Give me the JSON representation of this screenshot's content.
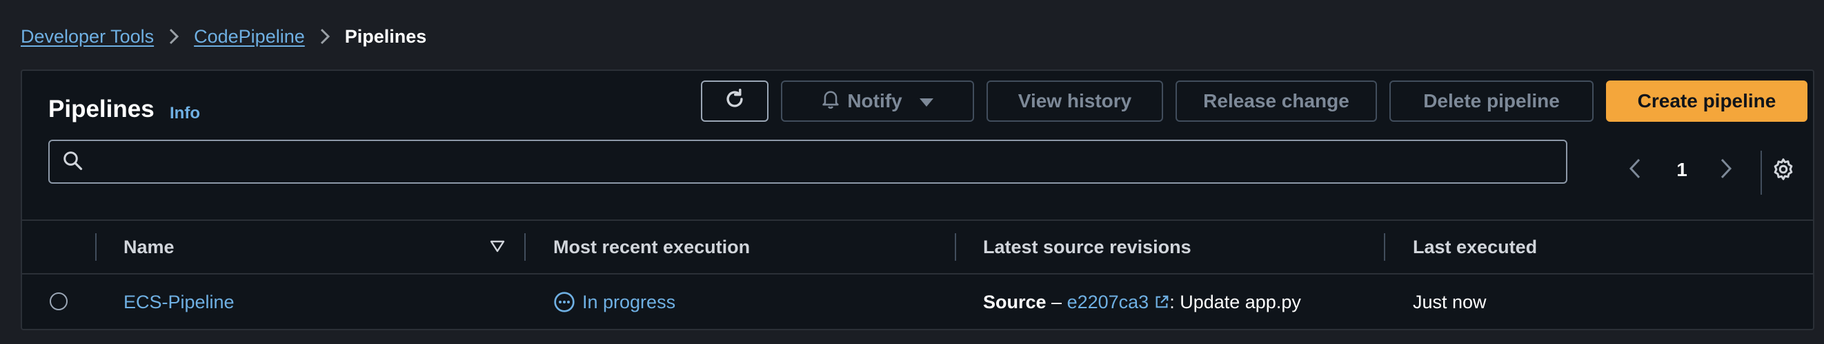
{
  "breadcrumb": {
    "items": [
      "Developer Tools",
      "CodePipeline"
    ],
    "current": "Pipelines"
  },
  "panel": {
    "title": "Pipelines",
    "info": "Info"
  },
  "toolbar": {
    "notify_label": "Notify",
    "view_history_label": "View history",
    "release_change_label": "Release change",
    "delete_label": "Delete pipeline",
    "create_label": "Create pipeline"
  },
  "search": {
    "value": "",
    "placeholder": ""
  },
  "pagination": {
    "current_page": "1"
  },
  "table": {
    "columns": [
      "Name",
      "Most recent execution",
      "Latest source revisions",
      "Last executed"
    ],
    "rows": [
      {
        "name": "ECS-Pipeline",
        "status": "In progress",
        "source_label": "Source",
        "source_dash": " – ",
        "revision_id": "e2207ca3",
        "revision_message": ": Update app.py",
        "last_executed": "Just now"
      }
    ]
  },
  "colors": {
    "link": "#6fb0e3",
    "primary_button": "#f4a63b",
    "background": "#1b1e24",
    "panel": "#0f141a"
  },
  "icons": [
    "chevron-right-icon",
    "refresh-icon",
    "bell-icon",
    "caret-down-icon",
    "search-icon",
    "chevron-left-icon",
    "gear-icon",
    "sort-descending-icon",
    "in-progress-icon",
    "external-link-icon"
  ]
}
